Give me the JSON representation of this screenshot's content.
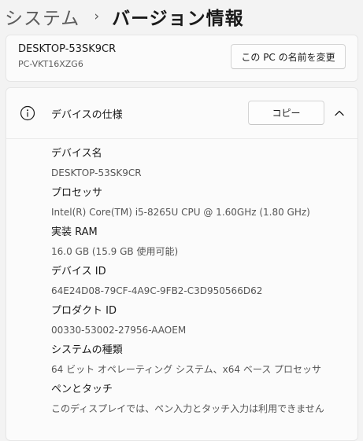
{
  "breadcrumb": {
    "parent": "システム",
    "separator": "›",
    "current": "バージョン情報"
  },
  "device_card": {
    "name": "DESKTOP-53SK9CR",
    "subtitle": "PC-VKT16XZG6",
    "rename_button": "この PC の名前を変更"
  },
  "specs": {
    "title": "デバイスの仕様",
    "copy_button": "コピー",
    "icons": {
      "header": "info-icon",
      "toggle": "chevron-up-icon"
    },
    "rows": [
      {
        "label": "デバイス名",
        "value": "DESKTOP-53SK9CR"
      },
      {
        "label": "プロセッサ",
        "value": "Intel(R) Core(TM) i5-8265U CPU @ 1.60GHz (1.80 GHz)"
      },
      {
        "label": "実装 RAM",
        "value": "16.0 GB (15.9 GB 使用可能)"
      },
      {
        "label": "デバイス ID",
        "value": "64E24D08-79CF-4A9C-9FB2-C3D950566D62"
      },
      {
        "label": "プロダクト ID",
        "value": "00330-53002-27956-AAOEM"
      },
      {
        "label": "システムの種類",
        "value": "64 ビット オペレーティング システム、x64 ベース プロセッサ"
      },
      {
        "label": "ペンとタッチ",
        "value": "このディスプレイでは、ペン入力とタッチ入力は利用できません"
      }
    ]
  }
}
